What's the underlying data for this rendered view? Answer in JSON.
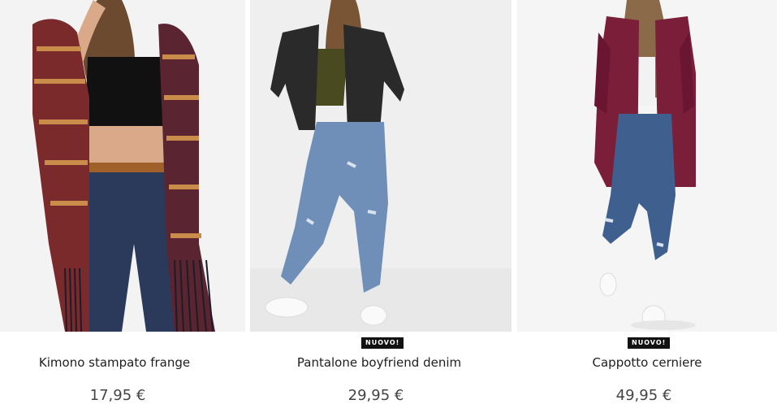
{
  "products": [
    {
      "name": "Kimono stampato frange",
      "price": "17,95 €",
      "badge": "",
      "image": "kimono-model-photo",
      "colors": {
        "garment": "#7a2a2a",
        "jeans": "#2b3a5a",
        "top": "#111111"
      }
    },
    {
      "name": "Pantalone boyfriend denim",
      "price": "29,95 €",
      "badge": "NUOVO!",
      "image": "boyfriend-denim-model-photo",
      "colors": {
        "jacket": "#2a2a2a",
        "jeans": "#6f8fb8",
        "top": "#4a4a20"
      }
    },
    {
      "name": "Cappotto cerniere",
      "price": "49,95 €",
      "badge": "NUOVO!",
      "image": "zip-coat-model-photo",
      "colors": {
        "coat": "#7a1e3a",
        "jeans": "#3f5f8f",
        "top": "#f2f2f2"
      }
    }
  ]
}
